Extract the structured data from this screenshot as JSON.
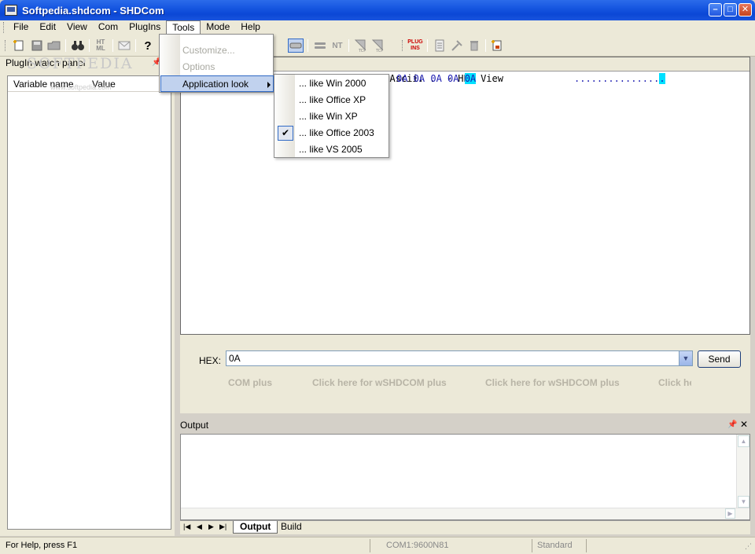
{
  "window": {
    "title": "Softpedia.shdcom - SHDCom"
  },
  "menu": {
    "items": [
      "File",
      "Edit",
      "View",
      "Com",
      "PlugIns",
      "Tools",
      "Mode",
      "Help"
    ],
    "open": "Tools"
  },
  "tools_menu": {
    "items": [
      {
        "label": "Customize...",
        "enabled": false
      },
      {
        "label": "Options",
        "enabled": false
      },
      {
        "label": "Application look",
        "enabled": true,
        "submenu": true,
        "highlighted": true
      }
    ]
  },
  "look_submenu": {
    "items": [
      {
        "label": "... like Win 2000",
        "checked": false
      },
      {
        "label": "... like Office XP",
        "checked": false
      },
      {
        "label": "... like Win XP",
        "checked": false
      },
      {
        "label": "... like Office 2003",
        "checked": true
      },
      {
        "label": "... like VS 2005",
        "checked": false
      }
    ]
  },
  "toolbar": {
    "icons": [
      "new-icon",
      "save-icon",
      "open-icon",
      "find-icon",
      "html-icon",
      "mail-icon",
      "help-icon",
      "connect-icon",
      "disconnect-icon",
      "nt-icon",
      "tcp-icon",
      "tcp2-icon",
      "plugins-icon",
      "doc-icon",
      "tools-icon",
      "delete-icon",
      "print-icon"
    ],
    "html_label": "HT ML",
    "nt_label": "NT",
    "plugins_label": "PLUG INS"
  },
  "plugin_panel": {
    "title": "PlugIn watch panel",
    "columns": [
      "Variable name",
      "Value"
    ],
    "watermark": "SOFTPEDIA",
    "watermark_sub": "www.softpedia.com"
  },
  "hex_view": {
    "header": "010  Bin: 00001010  Ascii: .  - HEX View",
    "bytes": "0A 0A 0A 0A ",
    "selected_byte": "0A",
    "ascii_text": "...............",
    "ascii_selected": "."
  },
  "send": {
    "label": "HEX:",
    "value": "0A",
    "button": "Send",
    "promos": [
      "COM plus",
      "Click here for wSHDCOM plus",
      "Click here for wSHDCOM plus",
      "Click he"
    ]
  },
  "output": {
    "title": "Output",
    "tabs": [
      "Output",
      "Build"
    ],
    "active_tab": "Output"
  },
  "statusbar": {
    "help": "For Help, press F1",
    "port": "COM1:9600N81",
    "mode": "Standard"
  },
  "colors": {
    "titlebar": "#0b47d6",
    "menu_highlight": "#c1d2ee",
    "hex_selection": "#00e0ff",
    "hex_text": "#1a1ab0"
  }
}
